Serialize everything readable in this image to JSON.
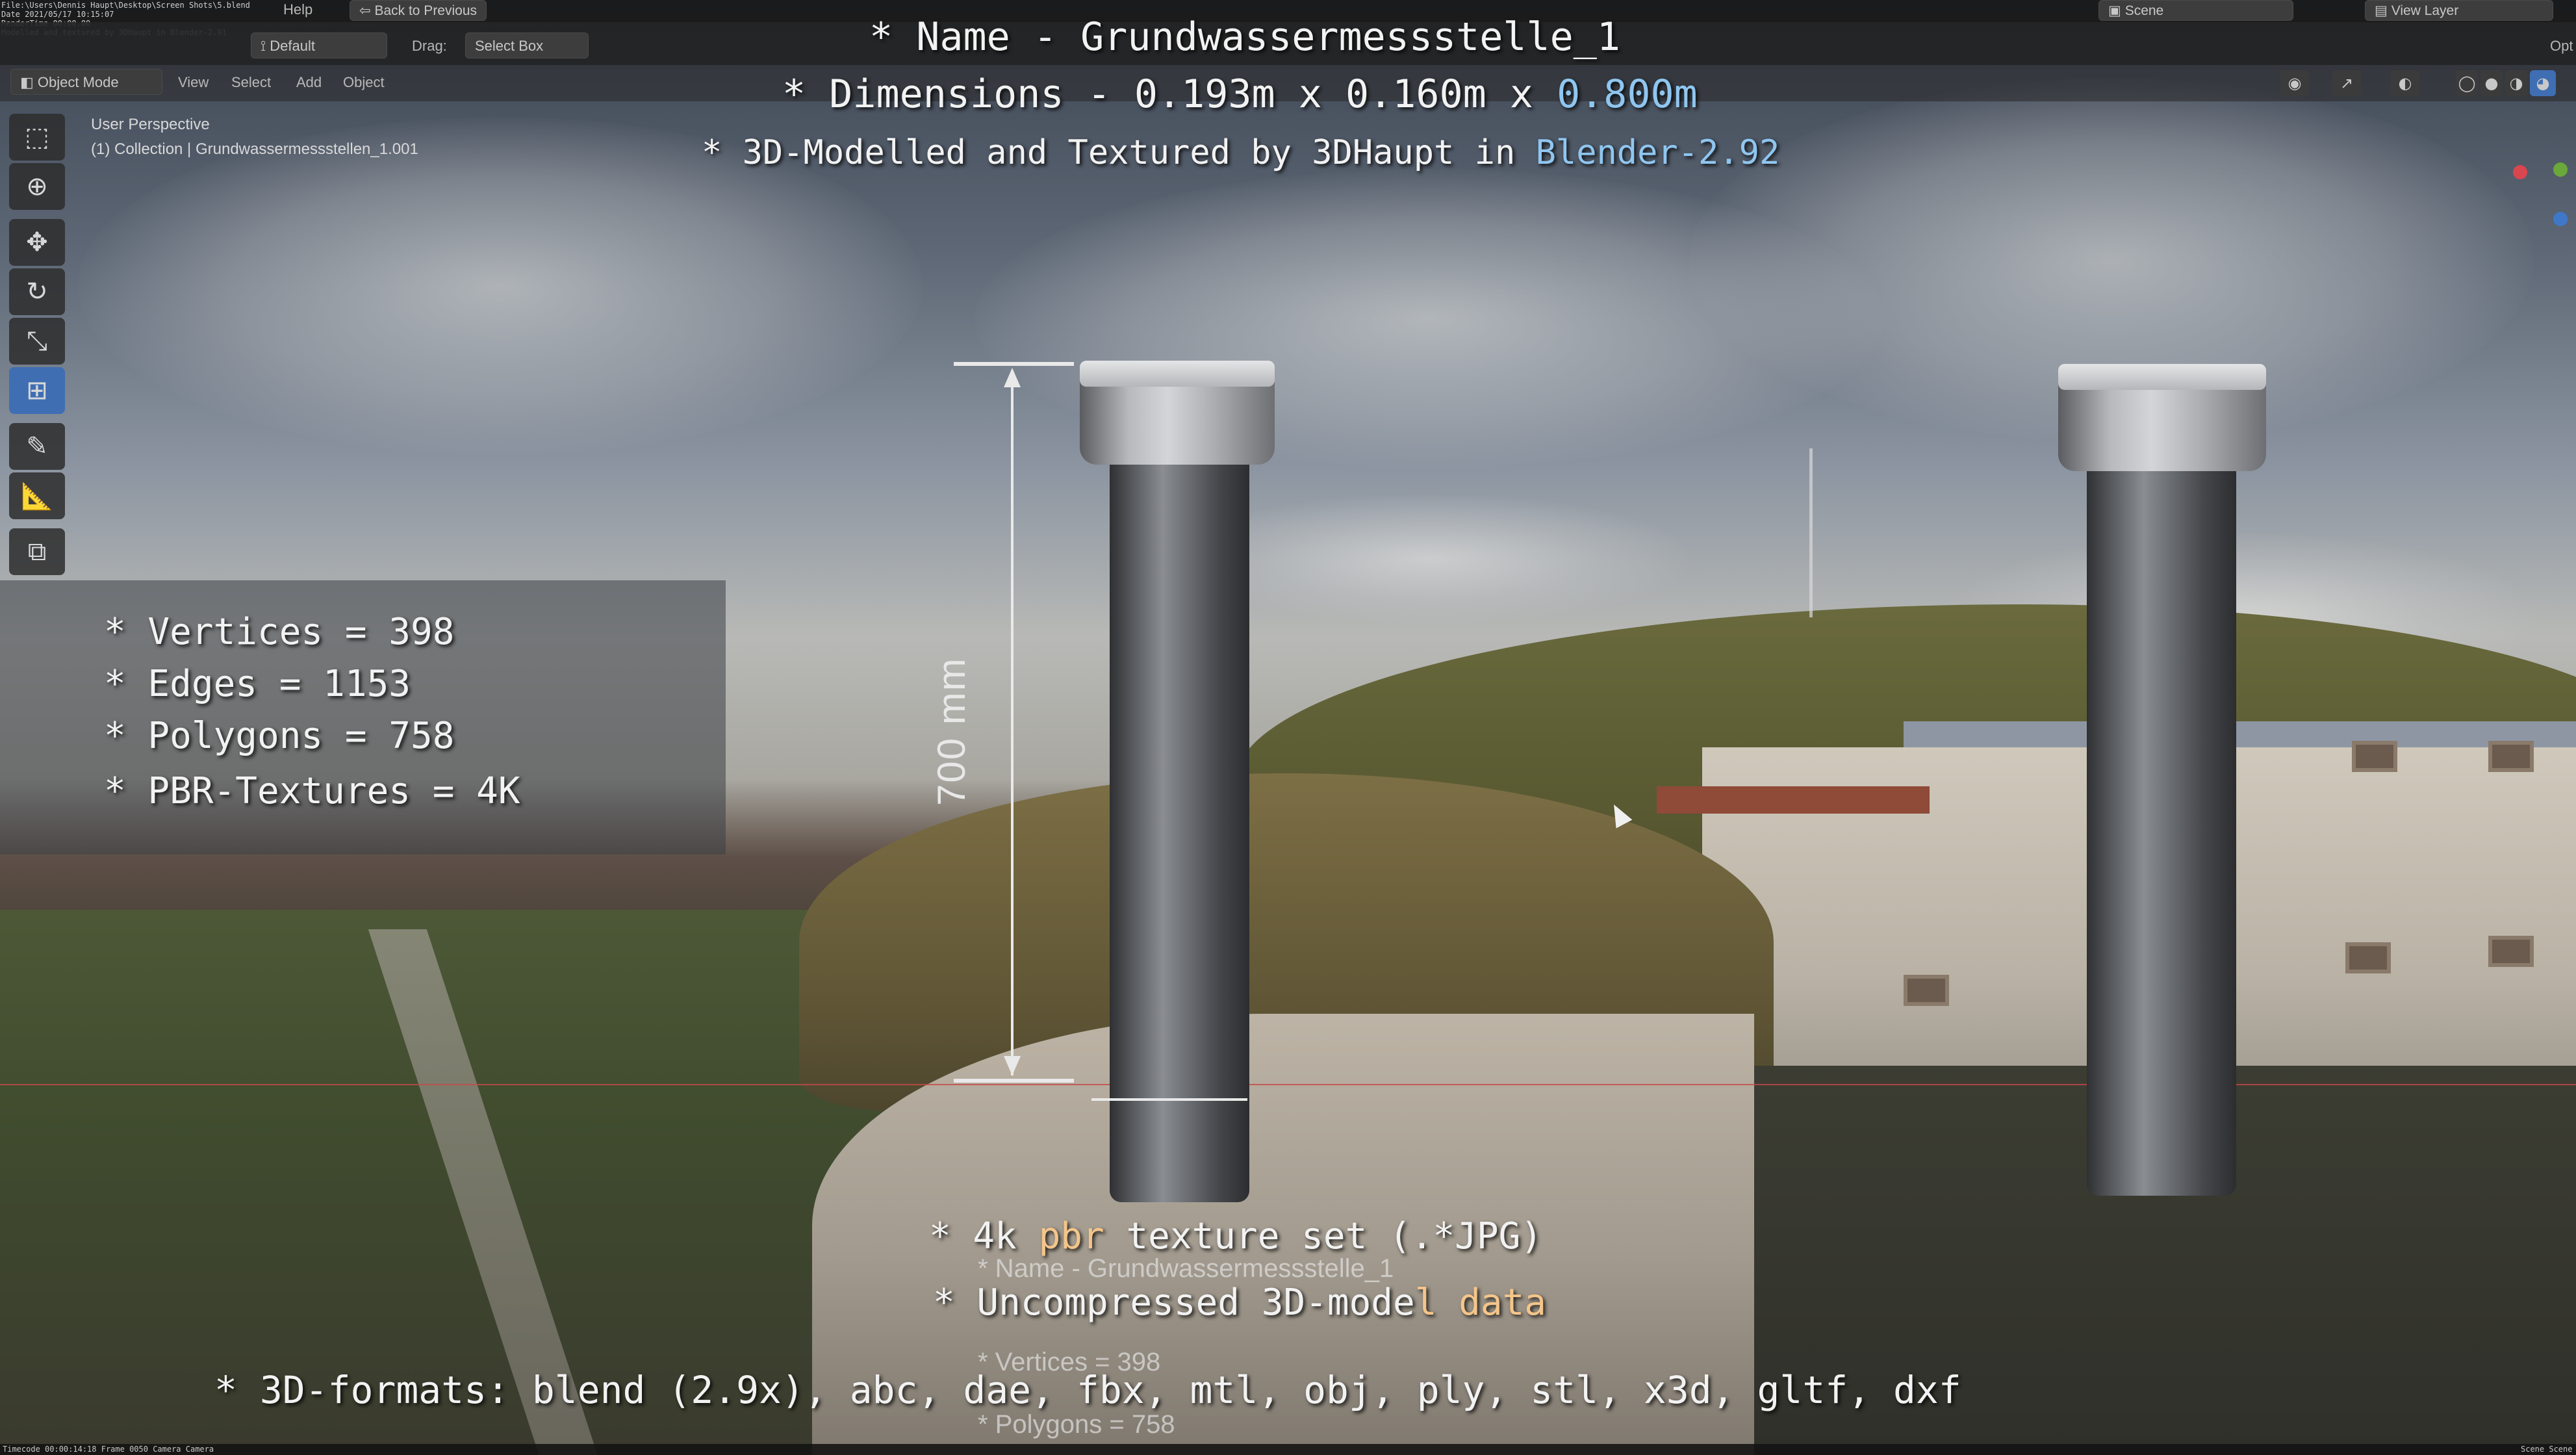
{
  "blender": {
    "menus": [
      "Help"
    ],
    "back_to_previous": "Back to Previous",
    "scene": "Scene",
    "view_layer": "View Layer",
    "orientation_default": "Default",
    "drag_label": "Drag:",
    "select_box": "Select Box",
    "mode": "Object Mode",
    "view": "View",
    "select": "Select",
    "add": "Add",
    "object": "Object",
    "opt": "Opt",
    "viewport_perspective": "User Perspective",
    "viewport_collection": "(1) Collection | Grundwassermessstellen_1.001",
    "tiny_info": "File:\\Users\\Dennis Haupt\\Desktop\\Screen Shots\\5.blend\nDate 2021/05/17 10:15:07\nRenderTime 00:00.00\nModelled and textured by 3DHaupt in Blender-2.91",
    "status_left": "Timecode 00:00:14:18   Frame 0050   Camera Camera",
    "status_right": "Scene Scene"
  },
  "overlay": {
    "name_line": "* Name - Grundwassermessstelle_1",
    "dimensions_prefix": "* Dimensions -  0.193m x 0.160m x ",
    "dimensions_highlight": "0.800m",
    "credit_prefix": "* 3D-Modelled and Textured by 3DHaupt in ",
    "credit_highlight": "Blender-2.92",
    "vertices": "* Vertices = 398",
    "edges": "* Edges = 1153",
    "polygons": "* Polygons = 758",
    "pbr": "* PBR-Textures = 4K",
    "texture_prefix": "* 4k ",
    "texture_highlight": "pbr",
    "texture_suffix": " texture set (.*JPG)",
    "uncompressed_prefix": "* Uncompressed 3D-mode",
    "uncompressed_highlight": "l data",
    "formats": "* 3D-formats: blend (2.9x), abc, dae, fbx, mtl, obj, ply, stl, x3d, gltf, dxf",
    "measure": "700 mm",
    "ghost_name": "* Name - Grundwassermessstelle_1",
    "ghost_vertices": "* Vertices = 398",
    "ghost_polygons": "* Polygons = 758"
  },
  "colors": {
    "accent_blue": "#8fc6f0",
    "accent_orange": "#f4c58a",
    "active_tool": "#3f6eb3"
  },
  "icons": [
    "select-box-icon",
    "cursor-icon",
    "move-icon",
    "rotate-icon",
    "scale-icon",
    "transform-icon",
    "annotate-icon",
    "measure-icon",
    "add-cube-icon"
  ]
}
